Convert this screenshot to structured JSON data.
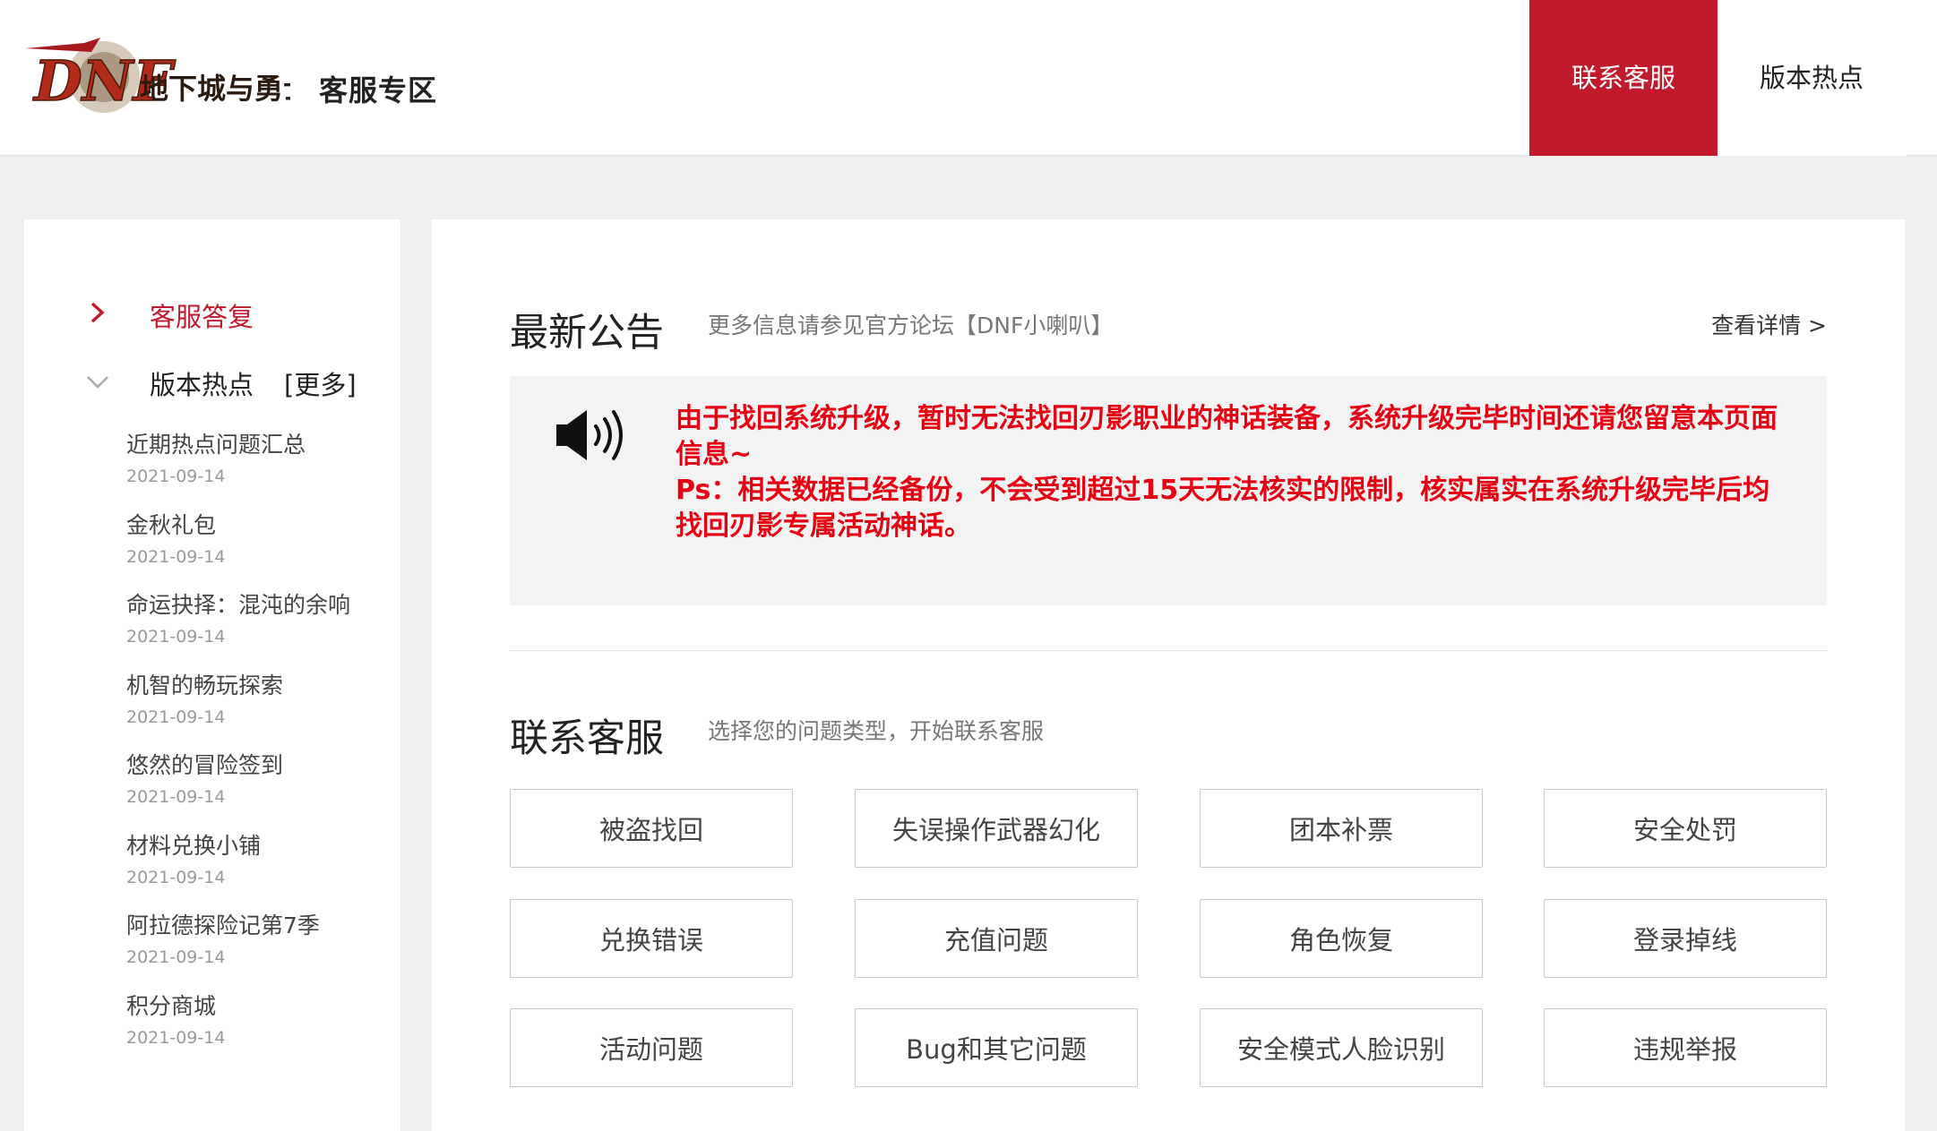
{
  "header": {
    "logo_text": "地下城与勇士",
    "section_title": "客服专区",
    "nav": [
      {
        "label": "联系客服",
        "active": true
      },
      {
        "label": "版本热点",
        "active": false
      }
    ]
  },
  "sidebar": {
    "reply_label": "客服答复",
    "hot_label": "版本热点",
    "more_label": "[更多]",
    "items": [
      {
        "title": "近期热点问题汇总",
        "date": "2021-09-14"
      },
      {
        "title": "金秋礼包",
        "date": "2021-09-14"
      },
      {
        "title": "命运抉择：混沌的余响",
        "date": "2021-09-14"
      },
      {
        "title": "机智的畅玩探索",
        "date": "2021-09-14"
      },
      {
        "title": "悠然的冒险签到",
        "date": "2021-09-14"
      },
      {
        "title": "材料兑换小铺",
        "date": "2021-09-14"
      },
      {
        "title": "阿拉德探险记第7季",
        "date": "2021-09-14"
      },
      {
        "title": "积分商城",
        "date": "2021-09-14"
      }
    ]
  },
  "announcement": {
    "title": "最新公告",
    "subtitle": "更多信息请参见官方论坛【DNF小喇叭】",
    "detail_link": "查看详情 >",
    "line1": "由于找回系统升级，暂时无法找回刃影职业的神话装备，系统升级完毕时间还请您留意本页面信息~",
    "line2": "Ps：相关数据已经备份，不会受到超过15天无法核实的限制，核实属实在系统升级完毕后均找回刃影专属活动神话。"
  },
  "contact": {
    "title": "联系客服",
    "subtitle": "选择您的问题类型，开始联系客服",
    "buttons": [
      "被盗找回",
      "失误操作武器幻化",
      "团本补票",
      "安全处罚",
      "兑换错误",
      "充值问题",
      "角色恢复",
      "登录掉线",
      "活动问题",
      "Bug和其它问题",
      "安全模式人脸识别",
      "违规举报"
    ]
  },
  "colors": {
    "accent": "#c01a2c",
    "notice_red": "#e60012",
    "page_bg": "#efefef"
  },
  "icons": {
    "logo": "dnf-logo-icon",
    "reply": "chevron-right-icon",
    "hot": "chevron-down-icon",
    "notice": "speaker-icon"
  }
}
